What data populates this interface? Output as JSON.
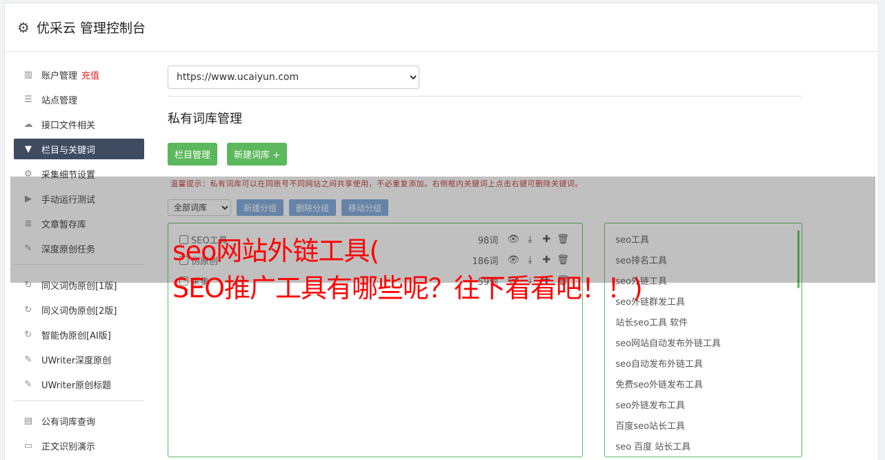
{
  "header": {
    "title": "优采云 管理控制台",
    "icon": "gear-icon"
  },
  "sidebar": {
    "items": [
      {
        "label": "账户管理",
        "icon": "bar-chart-icon",
        "extra": "充值"
      },
      {
        "label": "站点管理",
        "icon": "server-icon"
      },
      {
        "label": "接口文件相关",
        "icon": "cloud-upload-icon"
      },
      {
        "label": "栏目与关键词",
        "icon": "filter-icon",
        "active": true
      },
      {
        "label": "采集细节设置",
        "icon": "gears-icon"
      },
      {
        "label": "手动运行测试",
        "icon": "play-icon"
      },
      {
        "label": "文章暂存库",
        "icon": "database-icon"
      },
      {
        "label": "深度原创任务",
        "icon": "edit-icon"
      }
    ],
    "items2": [
      {
        "label": "同义词伪原创[1版]",
        "icon": "refresh-icon"
      },
      {
        "label": "同义词伪原创[2版]",
        "icon": "refresh-icon"
      },
      {
        "label": "智能伪原创[AI版]",
        "icon": "refresh-icon"
      },
      {
        "label": "UWriter深度原创",
        "icon": "edit-icon"
      },
      {
        "label": "UWriter原创标题",
        "icon": "edit-icon"
      }
    ],
    "items3": [
      {
        "label": "公有词库查询",
        "icon": "book-icon"
      },
      {
        "label": "正文识别演示",
        "icon": "monitor-icon"
      }
    ]
  },
  "main": {
    "site_select": "https://www.ucaiyun.com",
    "section_title": "私有词库管理",
    "btn_columns": "栏目管理",
    "btn_new_lib": "新建词库 +",
    "tip": "温馨提示：私有词库可以在同账号不同网站之间共享使用，不必重复添加。右侧框内关键词上点击右键可删除关键词。",
    "filter_select": "全部词库",
    "btn_new_group": "新建分组",
    "btn_delete_group": "删除分组",
    "btn_move_group": "移动分组",
    "groups": [
      {
        "name": "SEO工具",
        "count": "98词"
      },
      {
        "name": "伪原创",
        "count": "186词"
      },
      {
        "name": "采集",
        "count": "59词"
      }
    ],
    "keywords": [
      "seo工具",
      "seo排名工具",
      "seo外链工具",
      "seo外链群发工具",
      "站长seo工具 软件",
      "seo网站自动发布外链工具",
      "seo自动发布外链工具",
      "免费seo外链发布工具",
      "seo外链发布工具",
      "百度seo站长工具",
      "seo 百度 站长工具"
    ]
  },
  "overlay": {
    "line1": "seo网站外链工具(",
    "line2": "SEO推广工具有哪些呢？往下看看吧！！)"
  }
}
